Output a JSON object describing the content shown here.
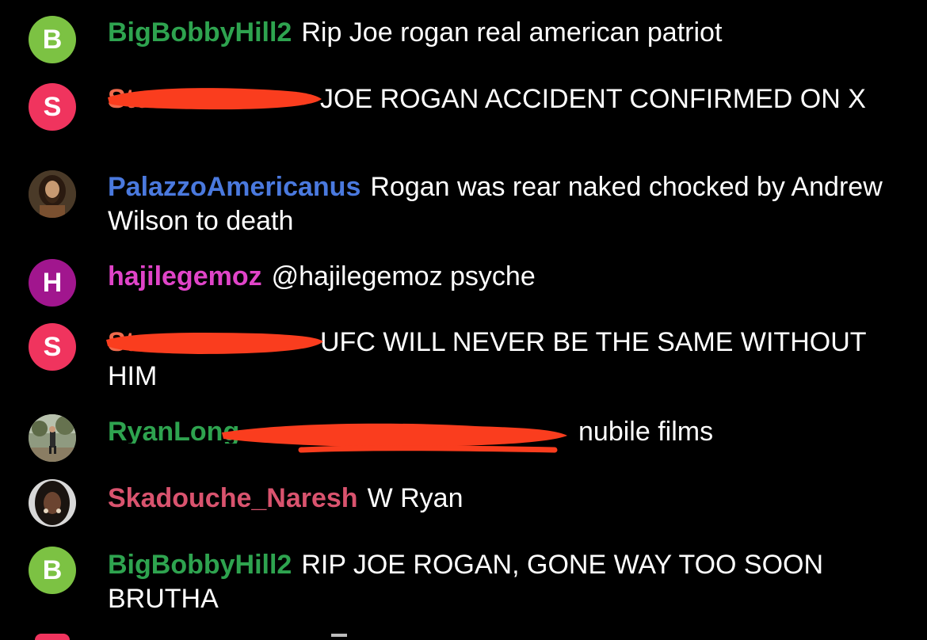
{
  "messages": [
    {
      "avatar_letter": "B",
      "avatar_color": "#7cc243",
      "username": "BigBobbyHill2",
      "username_color": "#2ea34f",
      "text": "Rip Joe rogan real american patriot"
    },
    {
      "avatar_letter": "S",
      "avatar_color": "#f0345e",
      "username": "Steven",
      "username_color": "#f06a4d",
      "username_redacted": true,
      "text": "JOE ROGAN ACCIDENT CONFIRMED ON X"
    },
    {
      "avatar_icon": "bearded-man-portrait",
      "username": "PalazzoAmericanus",
      "username_color": "#4a79de",
      "text": "Rogan was rear naked chocked by Andrew Wilson to death"
    },
    {
      "avatar_letter": "H",
      "avatar_color": "#a1168e",
      "username": "hajilegemoz",
      "username_color": "#e044c8",
      "text": "@hajilegemoz psyche"
    },
    {
      "avatar_letter": "S",
      "avatar_color": "#f0345e",
      "username": "Steven",
      "username_color": "#f06a4d",
      "username_redacted": true,
      "text": "UFC WILL NEVER BE THE SAME WITHOUT HIM"
    },
    {
      "avatar_icon": "outdoor-person-photo",
      "username": "RyanLong",
      "username_color": "#2ea34f",
      "username_redacted": true,
      "text": "nubile films"
    },
    {
      "avatar_icon": "woman-portrait",
      "username": "Skadouche_Naresh",
      "username_color": "#d9536e",
      "text": "W Ryan"
    },
    {
      "avatar_letter": "B",
      "avatar_color": "#7cc243",
      "username": "BigBobbyHill2",
      "username_color": "#2ea34f",
      "text": "RIP JOE ROGAN, GONE WAY TOO SOON BRUTHA"
    }
  ],
  "redaction_color": "#fa3d1e"
}
